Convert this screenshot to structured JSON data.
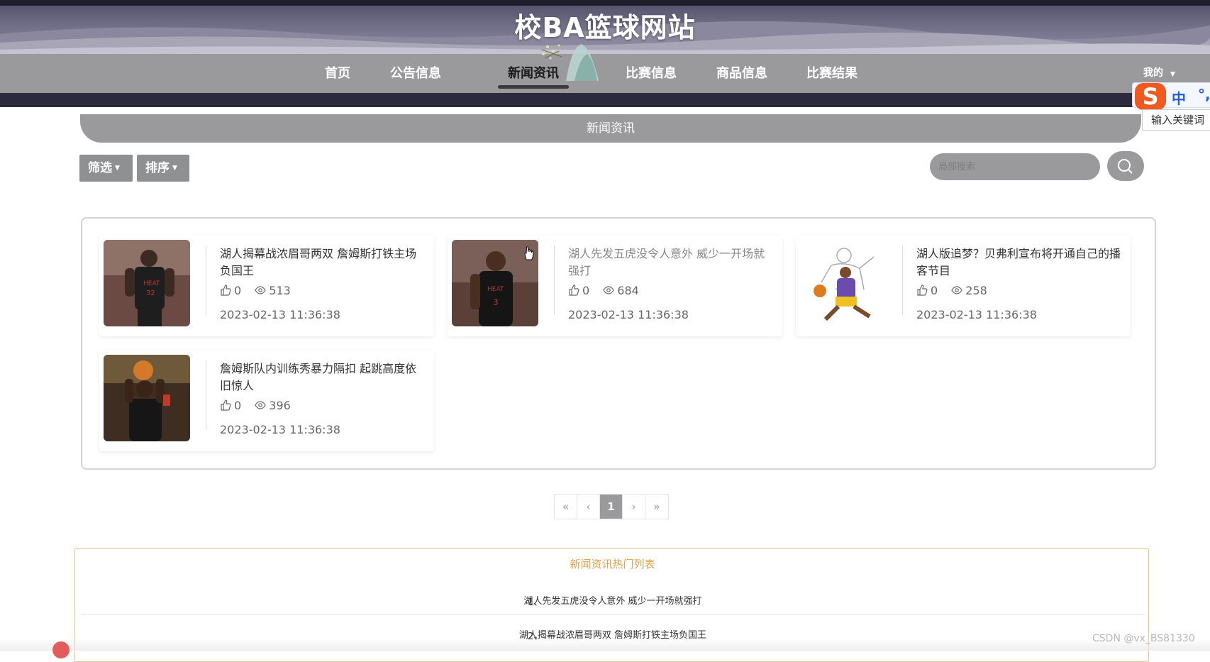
{
  "header": {
    "site_title": "校BA篮球网站"
  },
  "nav": {
    "items": [
      {
        "label": "首页"
      },
      {
        "label": "公告信息"
      },
      {
        "label": "新闻资讯"
      },
      {
        "label": "比赛信息"
      },
      {
        "label": "商品信息"
      },
      {
        "label": "比赛结果"
      }
    ],
    "active_index": 2,
    "me_label": "我的"
  },
  "ime": {
    "mode": "中",
    "logo": "S",
    "tip": "输入关键词"
  },
  "page": {
    "section_title": "新闻资讯",
    "filter_label": "筛选",
    "sort_label": "排序",
    "search_placeholder": "局部搜索"
  },
  "news": [
    {
      "title": "湖人揭幕战浓眉哥两双 詹姆斯打铁主场负国王",
      "likes": "0",
      "views": "513",
      "time": "2023-02-13 11:36:38",
      "thumb": "player-red-jersey"
    },
    {
      "title": "湖人先发五虎没令人意外 威少一开场就强打",
      "likes": "0",
      "views": "684",
      "time": "2023-02-13 11:36:38",
      "thumb": "player-black-jersey"
    },
    {
      "title": "湖人版追梦？贝弗利宣布将开通自己的播客节目",
      "likes": "0",
      "views": "258",
      "time": "2023-02-13 11:36:38",
      "thumb": "player-sketch"
    },
    {
      "title": "詹姆斯队内训练秀暴力隔扣 起跳高度依旧惊人",
      "likes": "0",
      "views": "396",
      "time": "2023-02-13 11:36:38",
      "thumb": "player-shooting"
    }
  ],
  "pager": {
    "first": "«",
    "prev": "‹",
    "current": "1",
    "next": "›",
    "last": "»"
  },
  "hot": {
    "title": "新闻资讯热门列表",
    "items": [
      {
        "index": "1、",
        "title": "湖人先发五虎没令人意外 威少一开场就强打"
      },
      {
        "index": "2、",
        "title": "湖人揭幕战浓眉哥两双 詹姆斯打铁主场负国王"
      }
    ]
  },
  "watermark": "CSDN @vx_BS81330",
  "colors": {
    "nav_bg": "#9a9a9c",
    "hot_title": "#e0a24a",
    "hot_border": "#e6c98a",
    "ime_logo": "#f05a1f",
    "ime_text": "#2060d8"
  }
}
